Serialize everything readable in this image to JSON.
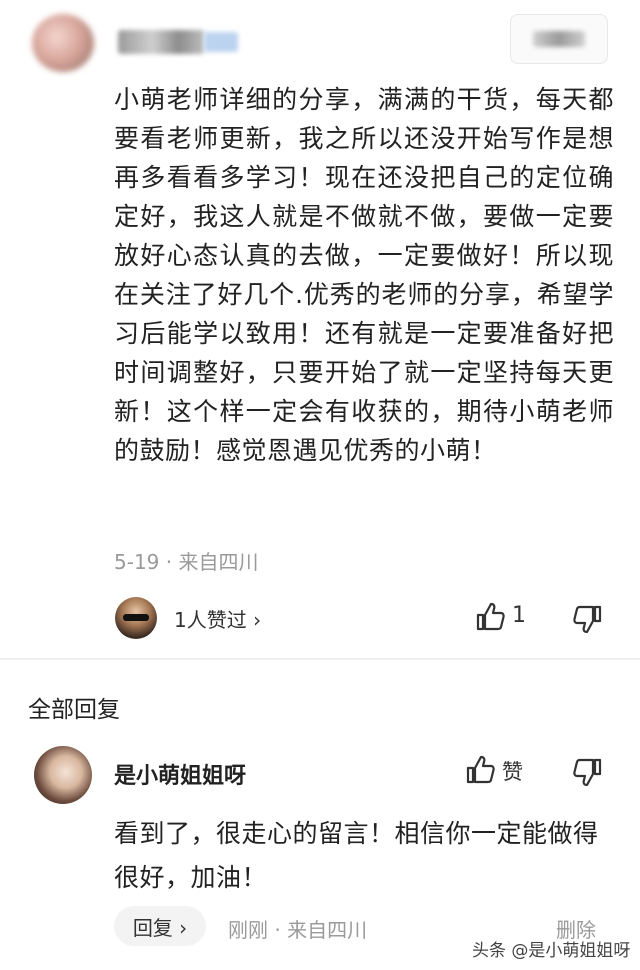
{
  "comment": {
    "text": "小萌老师详细的分享，满满的干货，每天都要看老师更新，我之所以还没开始写作是想再多看看多学习！现在还没把自己的定位确定好，我这人就是不做就不做，要做一定要放好心态认真的去做，一定要做好！所以现在关注了好几个.优秀的老师的分享，希望学习后能学以致用！还有就是一定要准备好把时间调整好，只要开始了就一定坚持每天更新！这个样一定会有收获的，期待小萌老师的鼓励！感觉恩遇见优秀的小萌！",
    "meta": "5-19 · 来自四川",
    "likes_text": "1人赞过 ›",
    "up_count": "1"
  },
  "replies": {
    "section_title": "全部回复",
    "items": [
      {
        "name": "是小萌姐姐呀",
        "like_label": "赞",
        "text": "看到了，很走心的留言！相信你一定能做得很好，加油！",
        "reply_button": "回复 ›",
        "meta": "刚刚 · 来自四川",
        "delete_label": "删除"
      }
    ]
  },
  "watermark": "头条 @是小萌姐姐呀",
  "icons": {
    "like": "thumb-up-icon",
    "dislike": "thumb-down-icon"
  }
}
